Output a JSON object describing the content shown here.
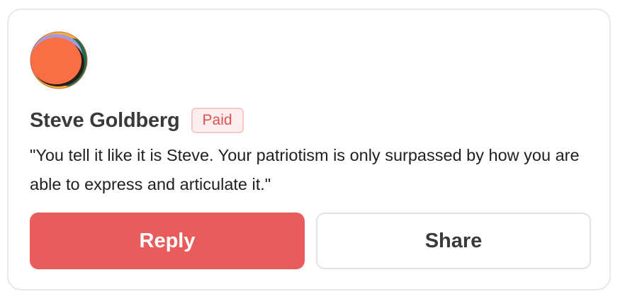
{
  "comment_card": {
    "author": "Steve Goldberg",
    "badge": "Paid",
    "text": "\"You tell it like it is Steve. Your patriotism is only surpassed by how you are able to express and articulate it.\"",
    "avatar_icon": "abstract-circle-avatar-icon",
    "colors": {
      "accent": "#e85c5c",
      "badge_bg": "#fdeeee",
      "badge_text": "#e05252"
    }
  },
  "actions": {
    "reply_label": "Reply",
    "share_label": "Share"
  }
}
